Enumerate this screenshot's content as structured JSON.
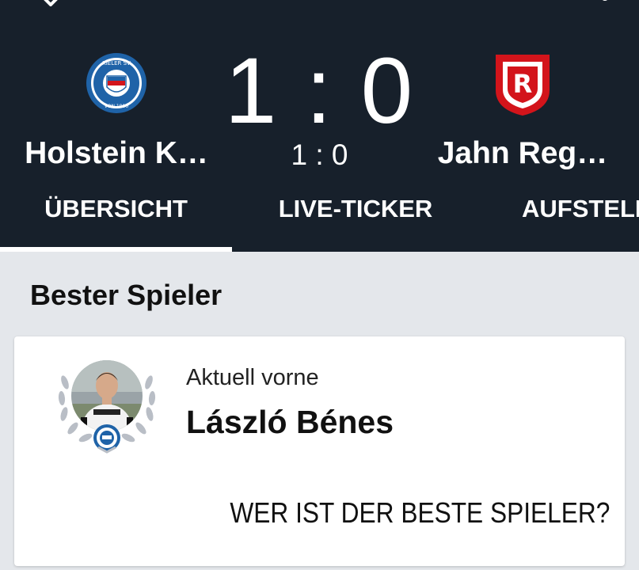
{
  "match": {
    "home_team": {
      "name": "Holstein K…",
      "crest_icon": "holstein-kiel-crest"
    },
    "away_team": {
      "name": "Jahn Reg…",
      "crest_icon": "jahn-regensburg-crest"
    },
    "score_main": "1 : 0",
    "score_sub": "1 : 0"
  },
  "tabs": [
    {
      "label": "ÜBERSICHT",
      "active": true
    },
    {
      "label": "LIVE-TICKER",
      "active": false
    },
    {
      "label": "AUFSTELL",
      "active": false
    }
  ],
  "best_player": {
    "section_title": "Bester Spieler",
    "subtitle": "Aktuell vorne",
    "name": "László Bénes",
    "vote_label": "WER IST DER BESTE SPIELER?"
  },
  "colors": {
    "header_bg": "#17202b",
    "page_bg": "#e4e7eb",
    "jahn_red": "#d3141b",
    "holstein_blue": "#1f63a8"
  }
}
